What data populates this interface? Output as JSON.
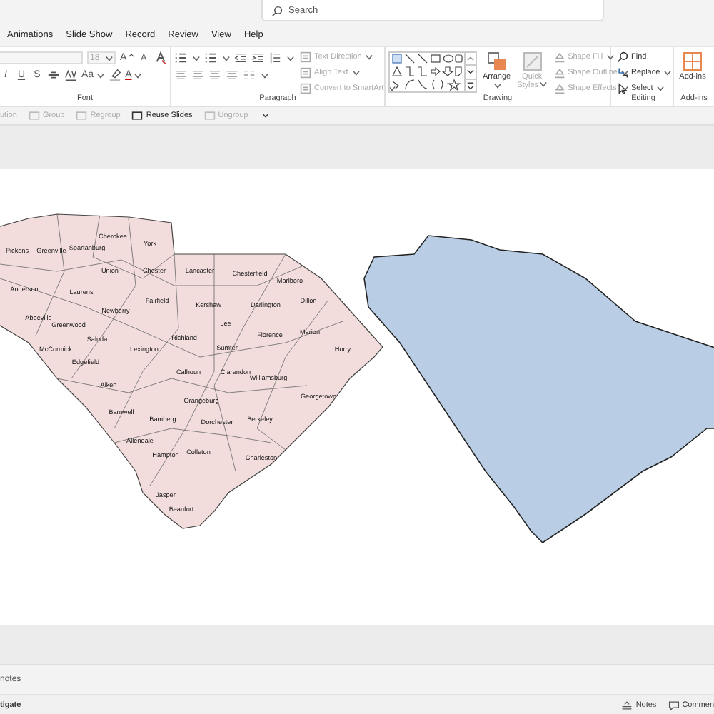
{
  "search": {
    "placeholder": "Search"
  },
  "tabs": [
    "Animations",
    "Slide Show",
    "Record",
    "Review",
    "View",
    "Help"
  ],
  "font_group": {
    "size": "18",
    "size_buttons": [
      "A",
      "A"
    ],
    "format_buttons": [
      "I",
      "U",
      "S",
      "Aa",
      "A"
    ],
    "label": "Font"
  },
  "paragraph_group": {
    "commands": [
      "Text Direction",
      "Align Text",
      "Convert to SmartArt"
    ],
    "label": "Paragraph"
  },
  "drawing_group": {
    "arrange": "Arrange",
    "quick_styles": "Quick Styles",
    "commands": [
      "Shape Fill",
      "Shape Outline",
      "Shape Effects"
    ],
    "label": "Drawing"
  },
  "editing_group": {
    "commands": [
      "Find",
      "Replace",
      "Select"
    ],
    "label": "Editing"
  },
  "addins_group": {
    "button": "Add-ins",
    "label": "Add-ins"
  },
  "quick_toolbar": [
    {
      "label": "ution",
      "disabled": true
    },
    {
      "label": "Group",
      "disabled": true
    },
    {
      "label": "Regroup",
      "disabled": true
    },
    {
      "label": "Reuse Slides",
      "disabled": false
    },
    {
      "label": "Ungroup",
      "disabled": true
    }
  ],
  "slide": {
    "county_labels": [
      "Pickens",
      "Greenville",
      "Spartanburg",
      "Cherokee",
      "York",
      "Union",
      "Chester",
      "Lancaster",
      "Chesterfield",
      "Marlboro",
      "Anderson",
      "Laurens",
      "Fairfield",
      "Kershaw",
      "Darlington",
      "Dillon",
      "Abbeville",
      "Newberry",
      "Greenwood",
      "Lee",
      "Florence",
      "Marion",
      "Saluda",
      "Richland",
      "McCormick",
      "Lexington",
      "Sumter",
      "Horry",
      "Edgefield",
      "Calhoun",
      "Clarendon",
      "Aiken",
      "Williamsburg",
      "Orangeburg",
      "Georgetown",
      "Barnwell",
      "Bamberg",
      "Dorchester",
      "Berkeley",
      "Allendale",
      "Hampton",
      "Colleton",
      "Charleston",
      "Jasper",
      "Beaufort"
    ]
  },
  "notes": {
    "placeholder": "notes"
  },
  "status_bar": {
    "left": "tigate",
    "buttons": [
      "Notes",
      "Commen"
    ]
  }
}
